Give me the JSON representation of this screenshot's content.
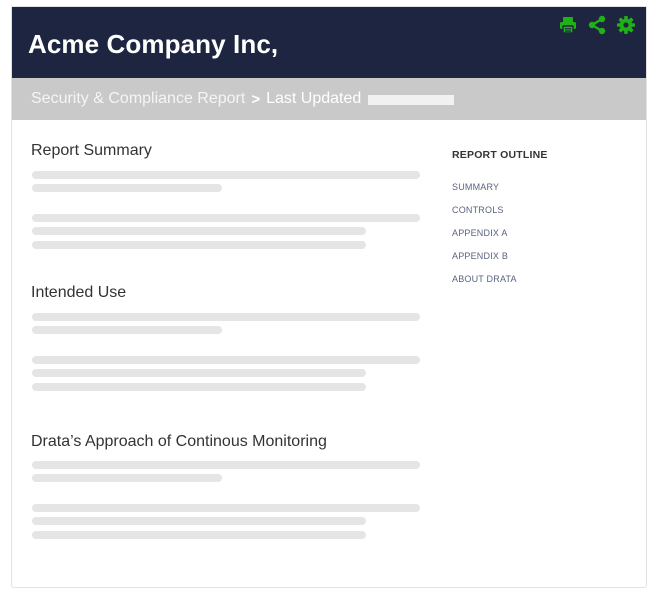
{
  "header": {
    "company_name": "Acme Company Inc,",
    "accent_color": "#20b116",
    "background_color": "#1d2540",
    "icons": [
      "print-icon",
      "share-icon",
      "gear-icon"
    ]
  },
  "breadcrumb": {
    "report_link": "Security & Compliance Report",
    "separator": ">",
    "last_updated_label": "Last Updated"
  },
  "sections": [
    {
      "title": "Report Summary"
    },
    {
      "title": "Intended Use"
    },
    {
      "title": "Drata’s Approach of Continous Monitoring"
    }
  ],
  "outline": {
    "title": "REPORT OUTLINE",
    "items": [
      {
        "label": "SUMMARY"
      },
      {
        "label": "CONTROLS"
      },
      {
        "label": "APPENDIX A"
      },
      {
        "label": "APPENDIX B"
      },
      {
        "label": "ABOUT DRATA"
      }
    ]
  }
}
